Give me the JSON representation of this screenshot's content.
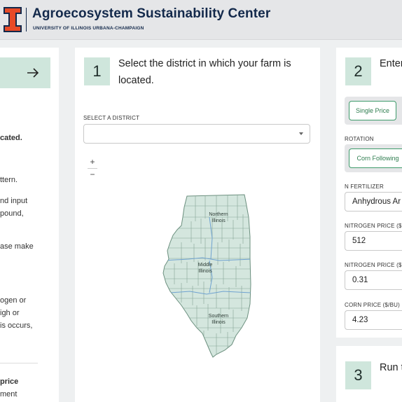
{
  "header": {
    "title": "Agroecosystem Sustainability Center",
    "subtitle": "UNIVERSITY OF ILLINOIS URBANA-CHAMPAIGN",
    "logo_icon": "illinois-block-i-logo",
    "brand_color": "#13294b",
    "logo_color": "#e84a27"
  },
  "left_panel": {
    "arrow_icon": "arrow-right-icon",
    "lines": [
      "cated.",
      "ttern.",
      "nd input",
      "pound,",
      "ase make",
      "ogen or",
      "igh or",
      "is occurs,",
      "price",
      "ment"
    ]
  },
  "step1": {
    "number": "1",
    "title": "Select the district in which your farm is located.",
    "select_label": "SELECT A DISTRICT",
    "select_value": "",
    "zoom_in": "+",
    "zoom_out": "−",
    "map": {
      "fill_color": "#d4e6de",
      "county_border": "#7a9a8a",
      "district_border": "#6fa2d0",
      "labels": {
        "northern_1": "Northern",
        "northern_2": "Illinois",
        "middle_1": "Middle",
        "middle_2": "Illinois",
        "southern_1": "Southern",
        "southern_2": "Illinois"
      }
    }
  },
  "step2": {
    "number": "2",
    "title": "Enter",
    "price_toggle": "Single Price",
    "rotation_label": "ROTATION",
    "rotation_value": "Corn Following",
    "n_fertilizer_label": "N FERTILIZER",
    "n_fertilizer_value": "Anhydrous Ar",
    "nitrogen_price_label_1": "NITROGEN PRICE ($",
    "nitrogen_price_value_1": "512",
    "nitrogen_price_label_2": "NITROGEN PRICE ($",
    "nitrogen_price_value_2": "0.31",
    "corn_price_label": "CORN PRICE ($/BU)",
    "corn_price_value": "4.23"
  },
  "step3": {
    "number": "3",
    "title": "Run t"
  }
}
